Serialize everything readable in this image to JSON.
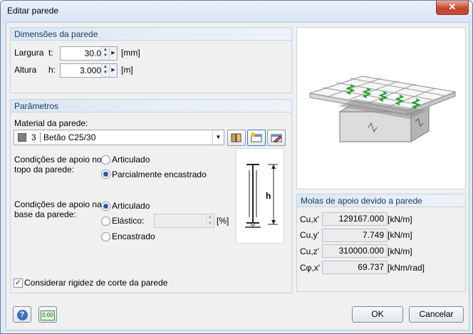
{
  "window": {
    "title": "Editar parede",
    "close_glyph": "✕"
  },
  "dimensions": {
    "header": "Dimensões da parede",
    "width": {
      "label": "Largura",
      "symbol": "t:",
      "value": "30.0",
      "unit": "[mm]"
    },
    "height": {
      "label": "Altura",
      "symbol": "h:",
      "value": "3.000",
      "unit": "[m]"
    }
  },
  "parameters": {
    "header": "Parâmetros",
    "material_label": "Material da parede:",
    "material": {
      "number": "3",
      "name": "Betão C25/30",
      "swatch_color": "#808080"
    },
    "top": {
      "label_line1": "Condições de apoio no",
      "label_line2": "topo da parede:",
      "options": [
        "Articulado",
        "Parcialmente encastrado"
      ],
      "selected": 1
    },
    "base": {
      "label_line1": "Condições de apoio na",
      "label_line2": "base da parede:",
      "options": [
        "Articulado",
        "Elástico:",
        "Encastrado"
      ],
      "selected": 0,
      "elastic_unit": "[%]"
    },
    "shear_checkbox": {
      "label": "Considerar rigidez de corte da parede",
      "checked": true,
      "mark": "✓"
    }
  },
  "diagram": {
    "dim_label": "h"
  },
  "springs": {
    "header": "Molas de apoio devido a parede",
    "rows": [
      {
        "label": "Cu,x'",
        "value": "129167.000",
        "unit": "[kN/m]"
      },
      {
        "label": "Cu,y'",
        "value": "7.749",
        "unit": "[kN/m]"
      },
      {
        "label": "Cu,z'",
        "value": "310000.000",
        "unit": "[kN/m]"
      },
      {
        "label": "Cφ,x'",
        "value": "69.737",
        "unit": "[kNm/rad]"
      }
    ]
  },
  "footer": {
    "ok": "OK",
    "cancel": "Cancelar",
    "help_glyph": "?",
    "units_glyph": "0.00"
  }
}
